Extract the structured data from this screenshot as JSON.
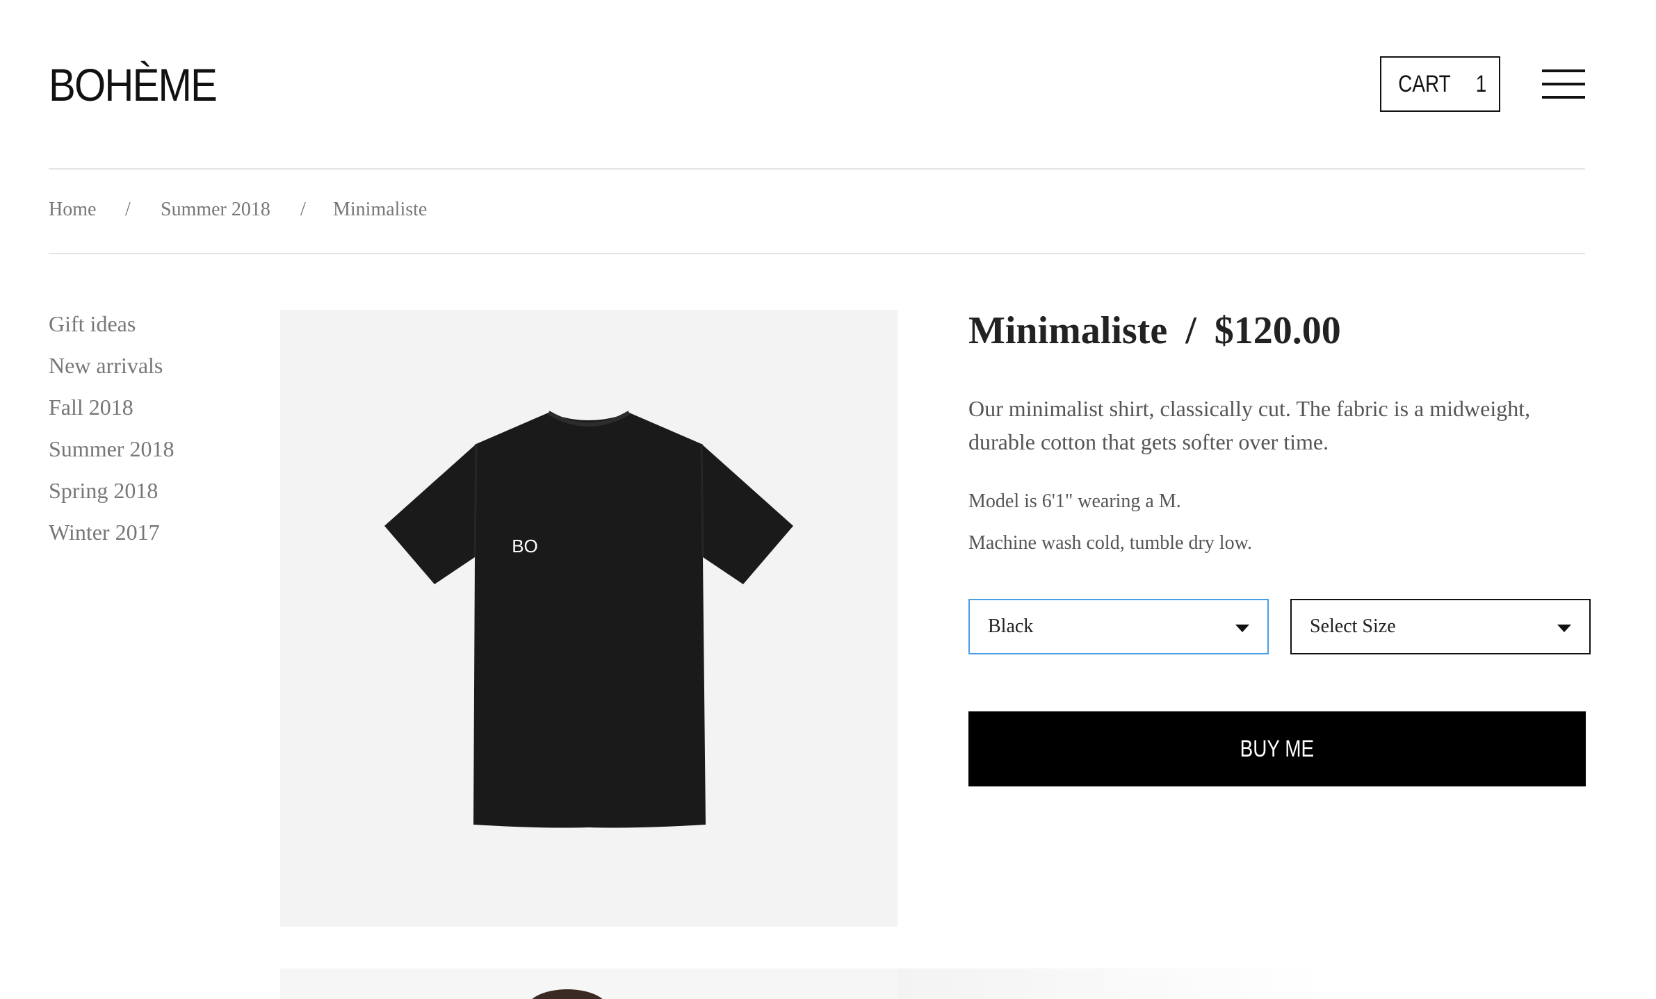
{
  "header": {
    "logo": "BOHÈME",
    "cart_label": "CART",
    "cart_count": "1",
    "menu_icon": "hamburger-menu-icon"
  },
  "breadcrumb": {
    "home": "Home",
    "separator": "/",
    "collection": "Summer 2018",
    "current": "Minimaliste"
  },
  "sidebar": {
    "items": [
      {
        "label": "Gift ideas"
      },
      {
        "label": "New arrivals"
      },
      {
        "label": "Fall 2018"
      },
      {
        "label": "Summer 2018"
      },
      {
        "label": "Spring 2018"
      },
      {
        "label": "Winter 2017"
      }
    ]
  },
  "product": {
    "name": "Minimaliste",
    "title_separator": "/",
    "price": "$120.00",
    "description": "Our minimalist shirt, classically cut. The fabric is a midweight, durable cotton that gets softer over time.",
    "model_note": "Model is 6'1\" wearing a M.",
    "care_note": "Machine wash cold, tumble dry low.",
    "shirt_print": "BO",
    "color_select": {
      "value": "Black"
    },
    "size_select": {
      "value": "Select Size"
    },
    "buy_label": "BUY ME"
  },
  "colors": {
    "accent_focus": "#4a9ee6",
    "button_bg": "#000000",
    "image_bg": "#f3f3f3"
  }
}
